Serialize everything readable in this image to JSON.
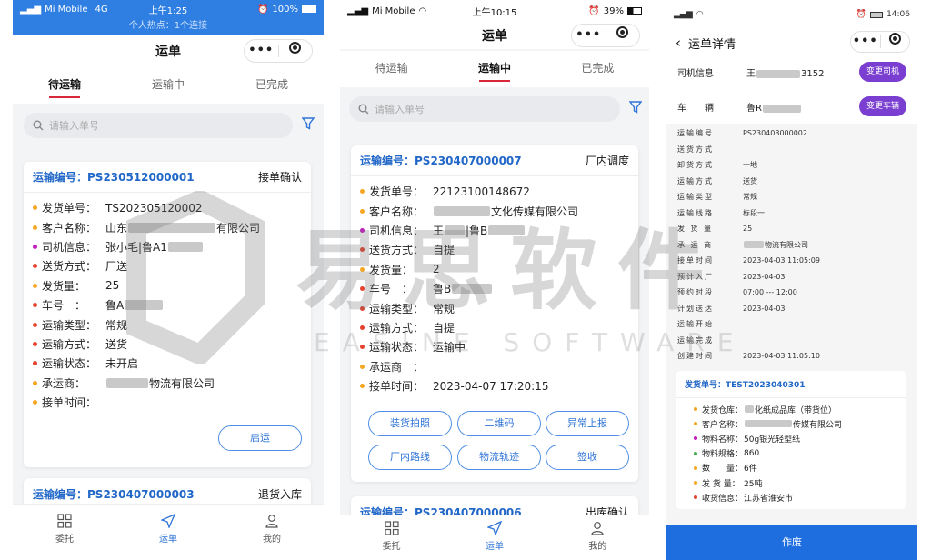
{
  "screen1": {
    "status": {
      "carrier": "Mi Mobile",
      "net": "4G",
      "time": "上午1:25",
      "battery": "100%"
    },
    "hotspot": "个人热点：1个连接",
    "title": "运单",
    "tabs": [
      "待运输",
      "运输中",
      "已完成"
    ],
    "search_placeholder": "请输入单号",
    "card1": {
      "no": "运输编号：PS230512000001",
      "status": "接单确认",
      "rows": [
        {
          "label": "发货单号：",
          "value": "TS202305120002",
          "color": "#f5a623"
        },
        {
          "label": "客户名称：",
          "value": "山东",
          "value2": "有限公司",
          "color": "#f5a623"
        },
        {
          "label": "司机信息：",
          "value": "张小毛|鲁A1",
          "color": "#c21bc1"
        },
        {
          "label": "送货方式：",
          "value": "厂送",
          "color": "#e5432f"
        },
        {
          "label": "发货量：",
          "value": "25",
          "color": "#f5a623"
        },
        {
          "label": "车号　：",
          "value": "鲁A",
          "color": "#e5432f"
        },
        {
          "label": "运输类型：",
          "value": "常规",
          "color": "#e5432f"
        },
        {
          "label": "运输方式：",
          "value": "送货",
          "color": "#e5432f"
        },
        {
          "label": "运输状态：",
          "value": "未开启",
          "color": "#e5432f"
        },
        {
          "label": "承运商：",
          "value": "物流有限公司",
          "color": "#f5a623"
        },
        {
          "label": "接单时间：",
          "value": "",
          "color": "#f5a623"
        }
      ],
      "button": "启运"
    },
    "card2": {
      "no": "运输编号：PS230407000003",
      "status": "退货入库"
    },
    "bottomnav": [
      "委托",
      "运单",
      "我的"
    ]
  },
  "screen2": {
    "status": {
      "carrier": "Mi Mobile",
      "time": "上午10:15",
      "battery": "39%"
    },
    "title": "运单",
    "tabs": [
      "待运输",
      "运输中",
      "已完成"
    ],
    "search_placeholder": "请输入单号",
    "card1": {
      "no": "运输编号：PS230407000007",
      "status": "厂内调度",
      "rows": [
        {
          "label": "发货单号：",
          "value": "22123100148672",
          "color": "#f5a623"
        },
        {
          "label": "客户名称：",
          "value": "文化传媒有限公司",
          "color": "#f5a623"
        },
        {
          "label": "司机信息：",
          "value": "王",
          "value2": "|鲁B",
          "color": "#c21bc1"
        },
        {
          "label": "送货方式：",
          "value": "自提",
          "color": "#e5432f"
        },
        {
          "label": "发货量：",
          "value": "2",
          "color": "#f5a623"
        },
        {
          "label": "车号　：",
          "value": "鲁B",
          "color": "#e5432f"
        },
        {
          "label": "运输类型：",
          "value": "常规",
          "color": "#e5432f"
        },
        {
          "label": "运输方式：",
          "value": "自提",
          "color": "#e5432f"
        },
        {
          "label": "运输状态：",
          "value": "运输中",
          "color": "#e5432f"
        },
        {
          "label": "承运商　：",
          "value": "",
          "color": "#f5a623"
        },
        {
          "label": "接单时间：",
          "value": "2023-04-07 17:20:15",
          "color": "#f5a623"
        }
      ],
      "buttons": [
        "装货拍照",
        "二维码",
        "异常上报",
        "厂内路线",
        "物流轨迹",
        "签收"
      ]
    },
    "card2": {
      "no": "运输编号：PS230407000006",
      "status": "出库确认"
    },
    "bottomnav": [
      "委托",
      "运单",
      "我的"
    ]
  },
  "screen3": {
    "status": {
      "time": "14:06"
    },
    "title": "运单详情",
    "driver_label": "司机信息",
    "driver_value": "王",
    "driver_value2": "3152",
    "change_driver": "变更司机",
    "vehicle_label": "车　　辆",
    "vehicle_value": "鲁R",
    "change_vehicle": "变更车辆",
    "rows": [
      {
        "label": "运输编号",
        "value": "PS230403000002"
      },
      {
        "label": "送货方式",
        "value": ""
      },
      {
        "label": "卸货方式",
        "value": "一地"
      },
      {
        "label": "运输方式",
        "value": "送货"
      },
      {
        "label": "运输类型",
        "value": "常规"
      },
      {
        "label": "运输线路",
        "value": "标段一"
      },
      {
        "label": "发 货 量",
        "value": "25"
      },
      {
        "label": "承 运 商",
        "value": "物流有限公司"
      },
      {
        "label": "接单时间",
        "value": "2023-04-03 11:05:09"
      },
      {
        "label": "预计入厂",
        "value": "2023-04-03"
      },
      {
        "label": "预约时段",
        "value": "07:00 --- 12:00"
      },
      {
        "label": "计划送达",
        "value": "2023-04-03"
      },
      {
        "label": "运输开始",
        "value": ""
      },
      {
        "label": "运输完成",
        "value": ""
      },
      {
        "label": "创建时间",
        "value": "2023-04-03 11:05:10"
      }
    ],
    "delivery": {
      "no": "发货单号：TEST2023040301",
      "rows": [
        {
          "label": "发货仓库：",
          "value": "化纸成品库（带货位）",
          "color": "#f5a623"
        },
        {
          "label": "客户名称：",
          "value": "传媒有限公司",
          "color": "#f5a623"
        },
        {
          "label": "物料名称：",
          "value": "50g银光轻型纸",
          "color": "#c21bc1"
        },
        {
          "label": "物料规格：",
          "value": "860",
          "color": "#3fae48"
        },
        {
          "label": "数　　量：",
          "value": "6件",
          "color": "#f5a623"
        },
        {
          "label": "发 货 量：",
          "value": "25吨",
          "color": "#f5a623"
        },
        {
          "label": "收货信息：",
          "value": "江苏省淮安市",
          "color": "#e5432f"
        }
      ]
    },
    "action": "作废"
  },
  "watermark": {
    "main": "易思软件",
    "sub": "EASINE SOFTWARE"
  }
}
